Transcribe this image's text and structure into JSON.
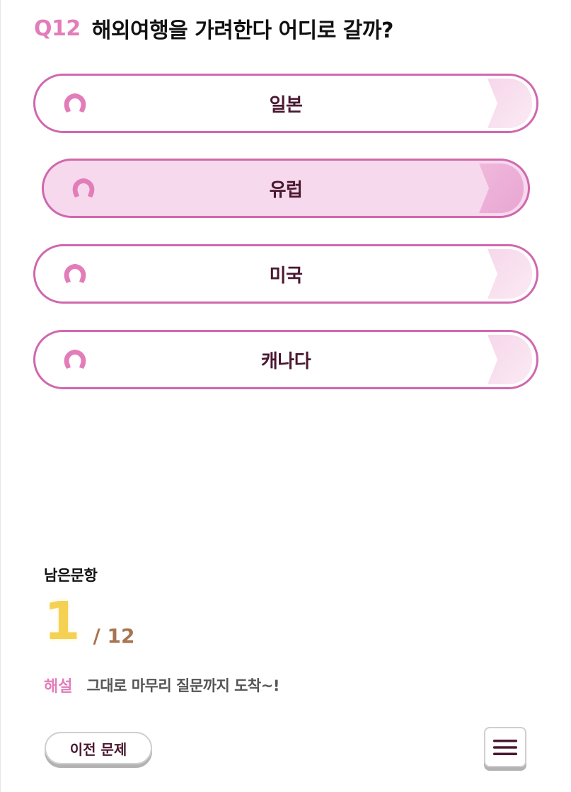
{
  "question": {
    "number": "Q12",
    "text": "해외여행을 가려한다 어디로 갈까?"
  },
  "options": [
    {
      "label": "일본",
      "selected": false,
      "icon": "horseshoe-icon"
    },
    {
      "label": "유럽",
      "selected": true,
      "icon": "horseshoe-icon"
    },
    {
      "label": "미국",
      "selected": false,
      "icon": "horseshoe-icon"
    },
    {
      "label": "캐나다",
      "selected": false,
      "icon": "horseshoe-icon"
    }
  ],
  "progress": {
    "label": "남은문항",
    "remaining": "1",
    "total": "/ 12"
  },
  "explanation": {
    "label": "해설",
    "text": "그대로 마무리 질문까지 도착~!"
  },
  "controls": {
    "prev_label": "이전 문제",
    "menu_icon": "hamburger-menu-icon"
  },
  "colors": {
    "accent_pink": "#e27db9",
    "option_border": "#d068ad",
    "selected_fill": "#f7d9ee",
    "label_text": "#4a1830",
    "remaining_number": "#f5d153",
    "total_number": "#a8744f"
  }
}
